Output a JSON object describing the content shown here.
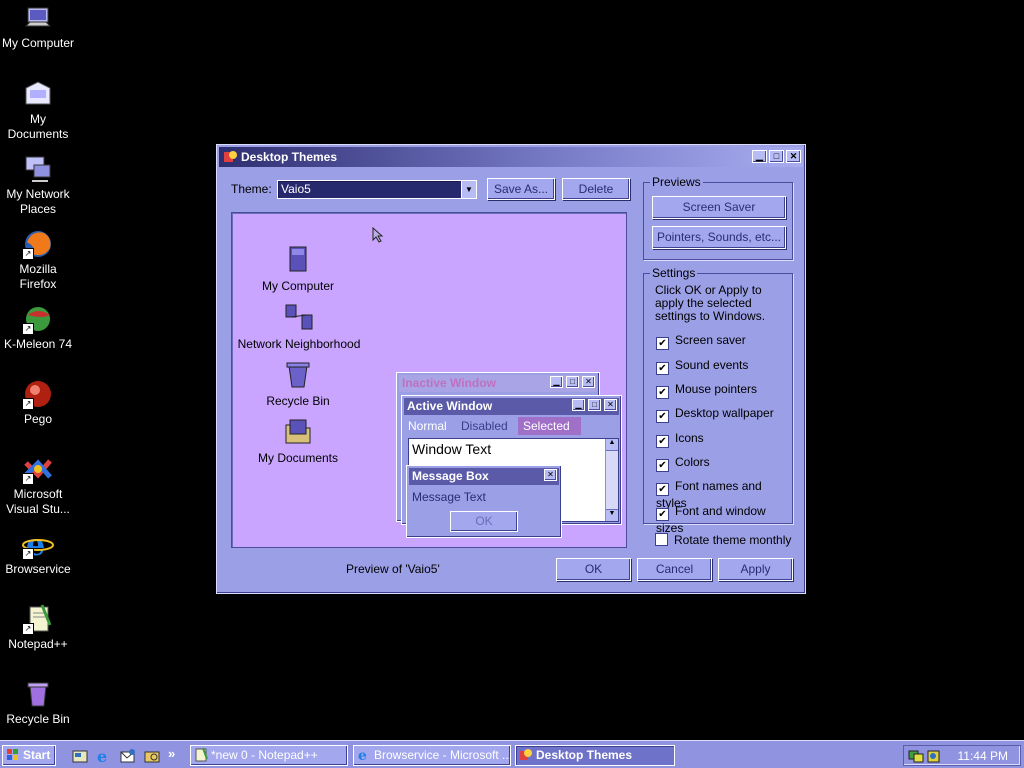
{
  "desktop_icons": [
    {
      "label": "My Computer",
      "icon": "computer-icon"
    },
    {
      "label": "My Documents",
      "icon": "documents-icon"
    },
    {
      "label": "My Network Places",
      "icon": "network-icon"
    },
    {
      "label": "Mozilla Firefox",
      "icon": "firefox-icon"
    },
    {
      "label": "K-Meleon 74",
      "icon": "kmeleon-icon"
    },
    {
      "label": "Pego",
      "icon": "pego-icon"
    },
    {
      "label": "Microsoft Visual Stu...",
      "icon": "visual-studio-icon"
    },
    {
      "label": "Browservice",
      "icon": "ie-icon"
    },
    {
      "label": "Notepad++",
      "icon": "notepadpp-icon"
    },
    {
      "label": "Recycle Bin",
      "icon": "recycle-bin-icon"
    }
  ],
  "window": {
    "title": "Desktop Themes",
    "theme_label": "Theme:",
    "theme_value": "Vaio5",
    "save_as": "Save As...",
    "delete": "Delete",
    "preview_caption": "Preview of 'Vaio5'",
    "ok": "OK",
    "cancel": "Cancel",
    "apply": "Apply",
    "previews_group": "Previews",
    "screen_saver_btn": "Screen Saver",
    "pointers_btn": "Pointers, Sounds, etc...",
    "settings_group": "Settings",
    "settings_desc": "Click OK or Apply to apply the selected settings to Windows.",
    "settings": [
      {
        "label": "Screen saver",
        "checked": true
      },
      {
        "label": "Sound events",
        "checked": true
      },
      {
        "label": "Mouse pointers",
        "checked": true
      },
      {
        "label": "Desktop wallpaper",
        "checked": true
      },
      {
        "label": "Icons",
        "checked": true
      },
      {
        "label": "Colors",
        "checked": true
      },
      {
        "label": "Font names and styles",
        "checked": true
      },
      {
        "label": "Font and window sizes",
        "checked": true
      }
    ],
    "rotate_label": "Rotate theme monthly",
    "rotate_checked": false
  },
  "preview": {
    "icons": [
      "My Computer",
      "Network Neighborhood",
      "Recycle Bin",
      "My Documents"
    ],
    "inactive_title": "Inactive Window",
    "active_title": "Active Window",
    "menu_normal": "Normal",
    "menu_disabled": "Disabled",
    "menu_selected": "Selected",
    "window_text": "Window Text",
    "msgbox_title": "Message Box",
    "msgbox_text": "Message Text",
    "msgbox_ok": "OK"
  },
  "taskbar": {
    "start": "Start",
    "chevron": "»",
    "items": [
      {
        "label": "*new 0 - Notepad++",
        "icon": "notepadpp-icon"
      },
      {
        "label": "Browservice - Microsoft ...",
        "icon": "ie-icon"
      },
      {
        "label": "Desktop Themes",
        "icon": "themes-icon"
      }
    ],
    "clock": "11:44 PM"
  },
  "colors": {
    "window_bg": "#9b9fe6",
    "preview_bg": "#c9a5ff",
    "title_dark": "#2e2e72"
  }
}
